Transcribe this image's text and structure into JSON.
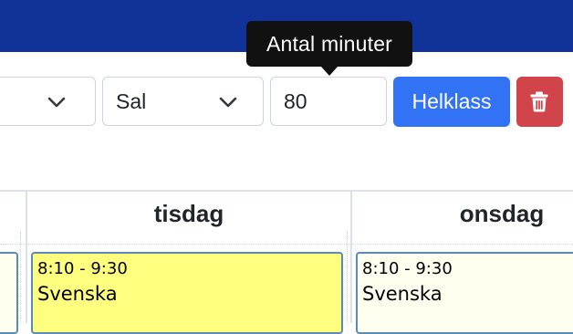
{
  "toolbar": {
    "course_select_value": "",
    "room_select": {
      "value": "Sal"
    },
    "minutes_input": {
      "value": "80",
      "tooltip": "Antal minuter"
    },
    "wholeclass_label": "Helklass",
    "delete_icon": "trash-icon"
  },
  "calendar": {
    "days": [
      {
        "label": "tisdag"
      },
      {
        "label": "onsdag"
      }
    ],
    "events": [
      {
        "time": "8:10 - 9:30",
        "subject": "Svenska",
        "day": "tisdag",
        "selected": true,
        "color": "#ffff7f"
      },
      {
        "time": "8:10 - 9:30",
        "subject": "Svenska",
        "day": "onsdag",
        "selected": false,
        "color": "#fffff0"
      }
    ]
  },
  "colors": {
    "header_bar": "#113298",
    "primary_button": "#3273f6",
    "danger_button": "#d1454a",
    "tooltip_bg": "#111111",
    "event_border": "#5b8bb7"
  }
}
